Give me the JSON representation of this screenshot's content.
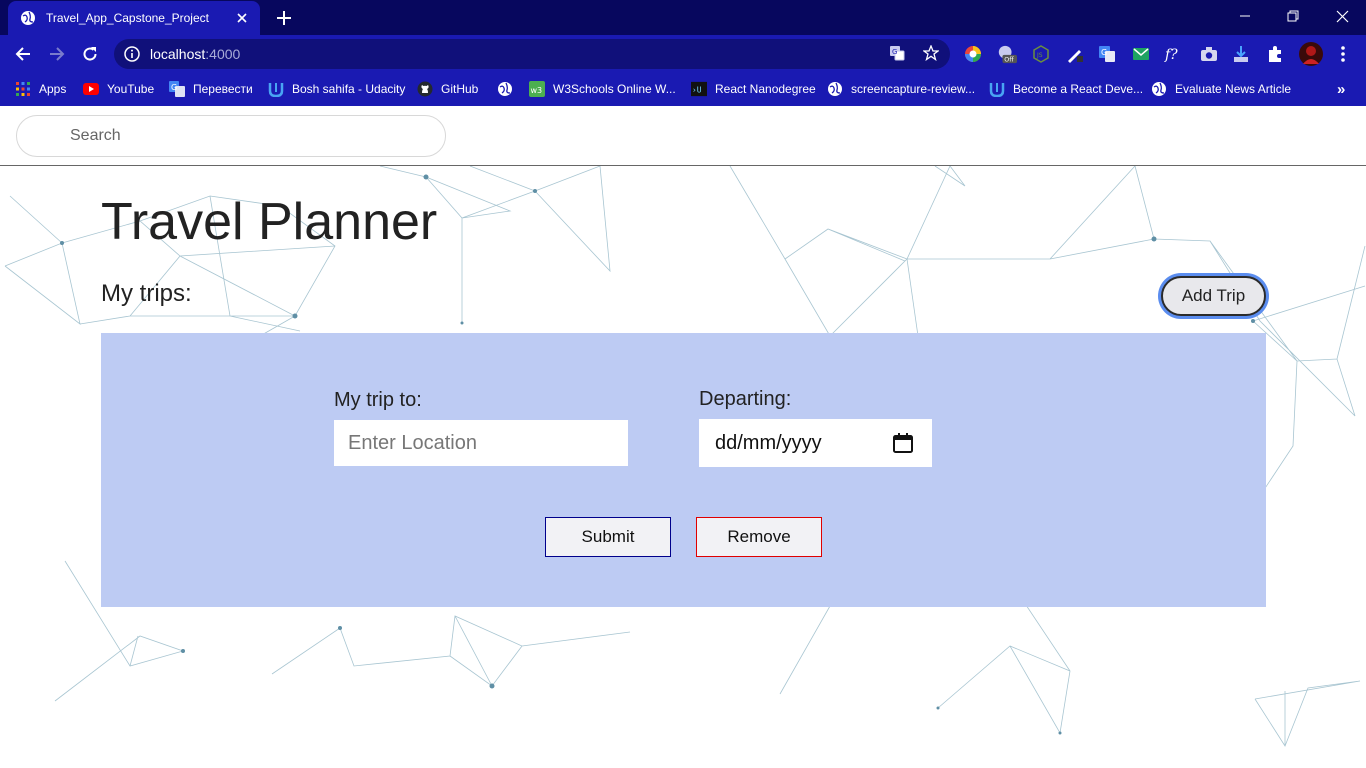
{
  "browser": {
    "tab_title": "Travel_App_Capstone_Project",
    "url_host": "localhost",
    "url_port": ":4000",
    "extension_badge": "Off",
    "bookmarks": [
      {
        "label": "Apps",
        "icon": "apps-grid-icon"
      },
      {
        "label": "YouTube",
        "icon": "youtube-icon"
      },
      {
        "label": "Перевести",
        "icon": "translate-icon"
      },
      {
        "label": "Bosh sahifa - Udacity",
        "icon": "udacity-icon"
      },
      {
        "label": "GitHub",
        "icon": "github-icon"
      },
      {
        "label": "",
        "icon": "globe-icon"
      },
      {
        "label": "W3Schools Online W...",
        "icon": "w3schools-icon"
      },
      {
        "label": "React Nanodegree",
        "icon": "udacity-dark-icon"
      },
      {
        "label": "screencapture-review...",
        "icon": "globe-icon"
      },
      {
        "label": "Become a React Deve...",
        "icon": "udacity-icon"
      },
      {
        "label": "Evaluate News Article",
        "icon": "globe-icon"
      }
    ],
    "more_bookmarks": "»"
  },
  "header": {
    "search_placeholder": "Search"
  },
  "main": {
    "title": "Travel Planner",
    "subtitle": "My trips:",
    "add_trip_label": "Add Trip"
  },
  "trip_form": {
    "destination_label": "My trip to:",
    "destination_placeholder": "Enter Location",
    "departing_label": "Departing:",
    "date_placeholder": "dd/mm/yyyy",
    "submit_label": "Submit",
    "remove_label": "Remove"
  },
  "colors": {
    "tab_strip": "#07075e",
    "toolbar": "#1a1ab2",
    "panel": "#bdcbf3",
    "submit_border": "#00008b",
    "remove_border": "#e00000",
    "add_trip_focus_ring": "#5b8def"
  }
}
